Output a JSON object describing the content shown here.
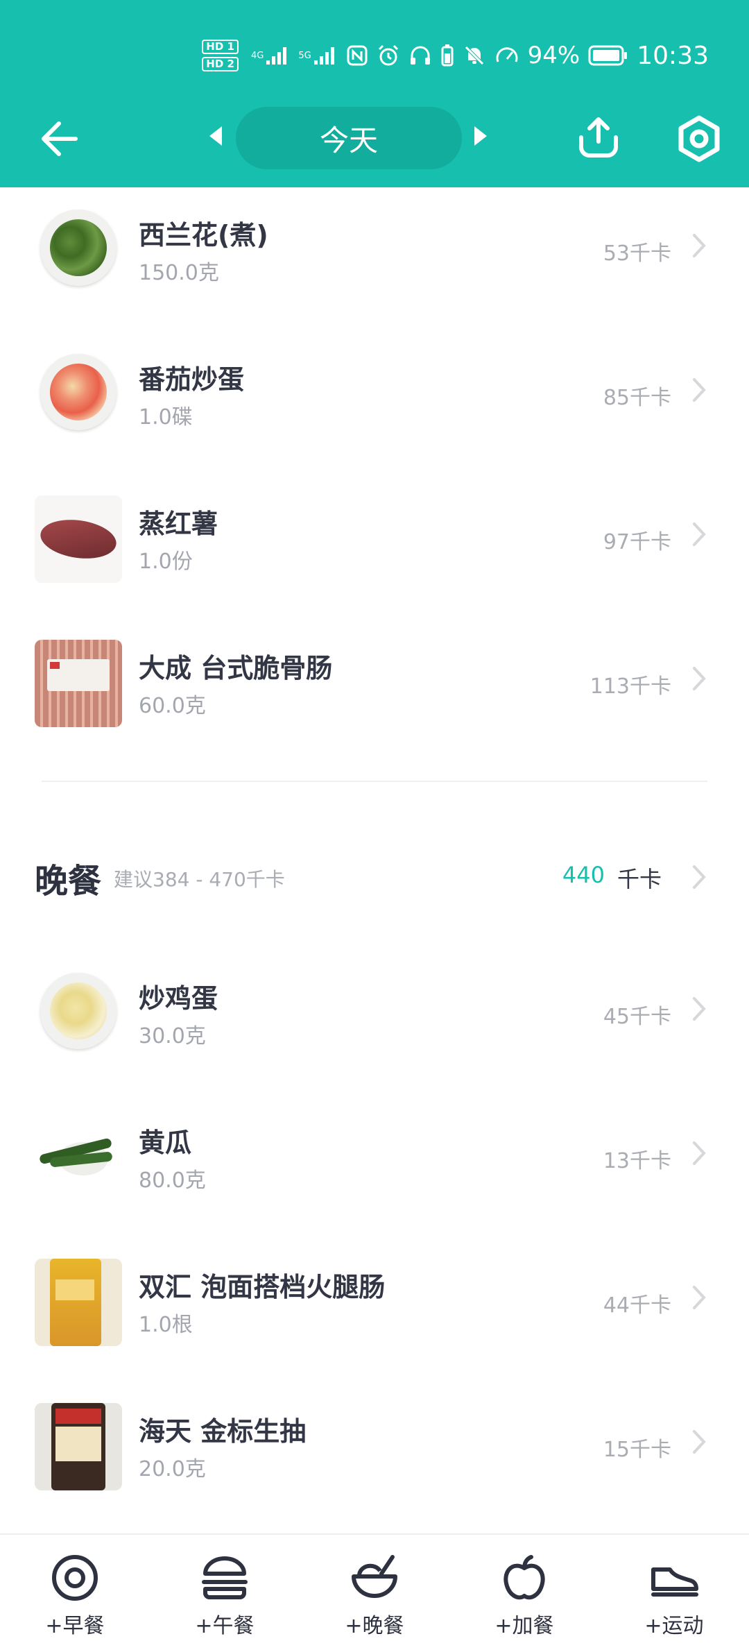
{
  "status_bar": {
    "hd1": "HD 1",
    "hd2": "HD 2",
    "sig1": "4G",
    "sig2": "5G",
    "battery_pct": "94%",
    "time": "10:33"
  },
  "header": {
    "date_label": "今天",
    "accent_color": "#16bfae"
  },
  "items_top": [
    {
      "name": "西兰花(煮)",
      "amount": "150.0克",
      "kcal": "53千卡"
    },
    {
      "name": "番茄炒蛋",
      "amount": "1.0碟",
      "kcal": "85千卡"
    },
    {
      "name": "蒸红薯",
      "amount": "1.0份",
      "kcal": "97千卡"
    },
    {
      "name": "大成 台式脆骨肠",
      "amount": "60.0克",
      "kcal": "113千卡"
    }
  ],
  "dinner": {
    "title": "晚餐",
    "hint": "建议384 - 470千卡",
    "value": "440",
    "unit": "千卡",
    "items": [
      {
        "name": "炒鸡蛋",
        "amount": "30.0克",
        "kcal": "45千卡"
      },
      {
        "name": "黄瓜",
        "amount": "80.0克",
        "kcal": "13千卡"
      },
      {
        "name": "双汇 泡面搭档火腿肠",
        "amount": "1.0根",
        "kcal": "44千卡"
      },
      {
        "name": "海天 金标生抽",
        "amount": "20.0克",
        "kcal": "15千卡"
      }
    ]
  },
  "bottom_tabs": [
    {
      "label": "+早餐",
      "icon": "egg-icon"
    },
    {
      "label": "+午餐",
      "icon": "burger-icon"
    },
    {
      "label": "+晚餐",
      "icon": "bowl-icon"
    },
    {
      "label": "+加餐",
      "icon": "apple-icon"
    },
    {
      "label": "+运动",
      "icon": "sneaker-icon"
    }
  ]
}
